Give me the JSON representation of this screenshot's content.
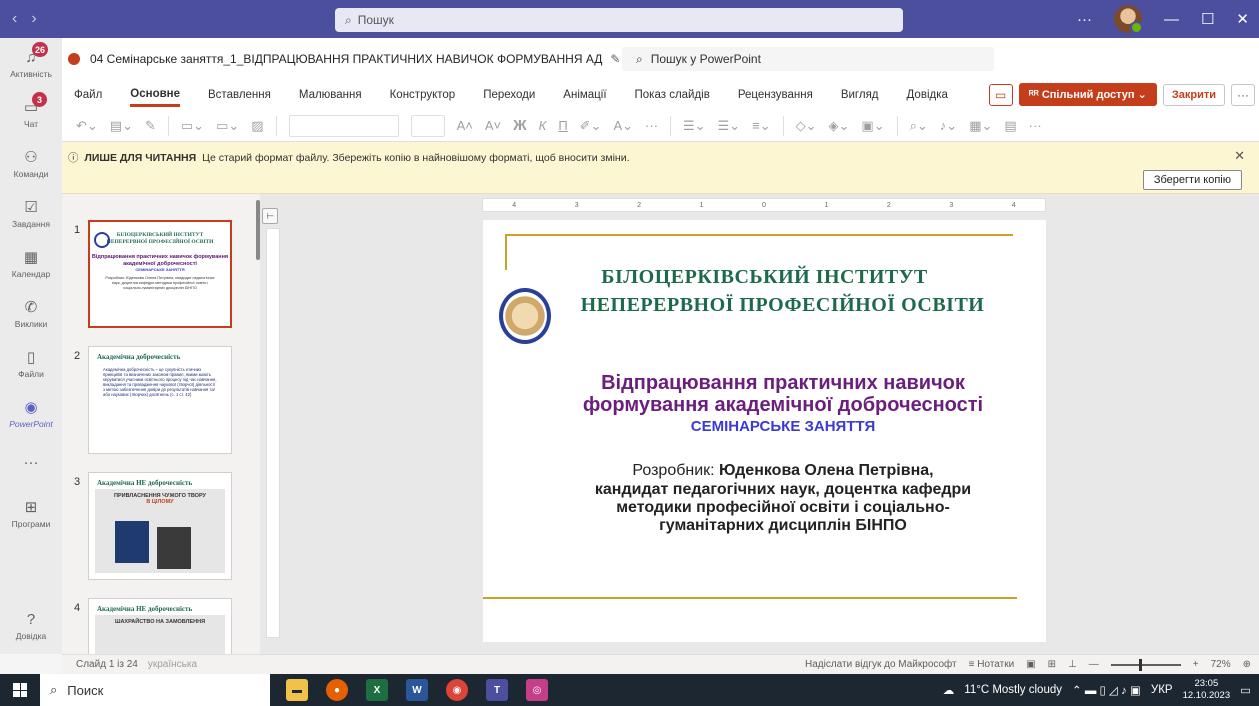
{
  "titlebar": {
    "back": "‹",
    "forward": "›",
    "search_placeholder": "Пошук",
    "more": "···",
    "minimize": "—",
    "maximize": "☐",
    "close": "✕"
  },
  "rail": {
    "items": [
      {
        "label": "Активність",
        "icon": "bell-icon",
        "badge": "26"
      },
      {
        "label": "Чат",
        "icon": "chat-icon",
        "badge": "3"
      },
      {
        "label": "Команди",
        "icon": "teams-icon",
        "badge": ""
      },
      {
        "label": "Завдання",
        "icon": "tasks-icon",
        "badge": ""
      },
      {
        "label": "Календар",
        "icon": "calendar-icon",
        "badge": ""
      },
      {
        "label": "Виклики",
        "icon": "phone-icon",
        "badge": ""
      },
      {
        "label": "Файли",
        "icon": "file-icon",
        "badge": ""
      },
      {
        "label": "PowerPoint",
        "icon": "powerpoint-icon",
        "badge": ""
      },
      {
        "label": "···",
        "icon": "more-icon",
        "badge": ""
      },
      {
        "label": "Програми",
        "icon": "apps-icon",
        "badge": ""
      }
    ],
    "help": "Довідка"
  },
  "document": {
    "title": "04 Семінарське заняття_1_ВІДПРАЦЮВАННЯ ПРАКТИЧНИХ НАВИЧОК ФОРМУВАННЯ АД",
    "search_placeholder": "Пошук у PowerPoint"
  },
  "menu": {
    "items": [
      "Файл",
      "Основне",
      "Вставлення",
      "Малювання",
      "Конструктор",
      "Переходи",
      "Анімації",
      "Показ слайдів",
      "Рецензування",
      "Вигляд",
      "Довідка"
    ],
    "active": "Основне",
    "share": "Спільний доступ",
    "close": "Закрити"
  },
  "infobar": {
    "bold": "ЛИШЕ ДЛЯ ЧИТАННЯ",
    "message": "Це старий формат файлу. Збережіть копію в найновішому форматі, щоб вносити зміни.",
    "save_copy": "Зберегти копію"
  },
  "thumbnails": [
    {
      "num": "1",
      "line1": "БІЛОЦЕРКІВСЬКИЙ ІНСТИТУТ",
      "line2": "НЕПЕРЕРВНОЇ ПРОФЕСІЙНОЇ ОСВІТИ",
      "title": "Відпрацювання практичних навичок формування академічної доброчесності",
      "sub": "СЕМІНАРСЬКЕ ЗАНЯТТЯ",
      "author": "Розробник: Юденкова Олена Петрівна, кандидат педагогічних наук, доцентка кафедри методики професійної освіти і соціально-гуманітарних дисциплін БІНПО"
    },
    {
      "num": "2",
      "header": "Академічна доброчесність",
      "body": "Академічна доброчесність – це сукупність етичних принципів та визначених законом правил, якими мають керуватися учасники освітнього процесу під час навчання, викладання та провадження наукової (творчої) діяльності з метою забезпечення довіри до результатів навчання та/або наукових (творчих) досягнень (с. 1 ст. 42)"
    },
    {
      "num": "3",
      "header": "Академічна НЕ доброчесність",
      "sub": "ПРИВЛАСНЕННЯ ЧУЖОГО ТВОРУ",
      "sub2": "В ЦІЛОМУ"
    },
    {
      "num": "4",
      "header": "Академічна НЕ доброчесність",
      "sub": "ШАХРАЙСТВО НА ЗАМОВЛЕННЯ"
    }
  ],
  "slide": {
    "inst_line1": "БІЛОЦЕРКІВСЬКИЙ ІНСТИТУТ",
    "inst_line2": "НЕПЕРЕРВНОЇ ПРОФЕСІЙНОЇ ОСВІТИ",
    "title_line1": "Відпрацювання практичних навичок",
    "title_line2": "формування академічної доброчесності",
    "seminar": "СЕМІНАРСЬКЕ ЗАНЯТТЯ",
    "author_prefix": "Розробник:",
    "author_name": "Юденкова Олена Петрівна,",
    "author_line2": "кандидат педагогічних наук, доцентка кафедри",
    "author_line3": "методики професійної освіти і соціально-",
    "author_line4": "гуманітарних дисциплін БІНПО"
  },
  "ruler": [
    "4",
    "3",
    "2",
    "1",
    "0",
    "1",
    "2",
    "3",
    "4"
  ],
  "statusbar": {
    "slide": "Слайд 1 із 24",
    "language": "українська",
    "feedback": "Надіслати відгук до Майкрософт",
    "notes": "Нотатки",
    "zoom": "72%"
  },
  "taskbar": {
    "search": "Поиск",
    "weather": "11°C  Mostly cloudy",
    "lang": "УКР",
    "time": "23:05",
    "date": "12.10.2023"
  },
  "colors": {
    "teams_purple": "#4b4f9e",
    "ppt_accent": "#c43e1c",
    "institute_green": "#1d6a4b",
    "title_purple": "#6b1e7d",
    "seminar_blue": "#3a3ad6",
    "gold": "#c9a227"
  }
}
